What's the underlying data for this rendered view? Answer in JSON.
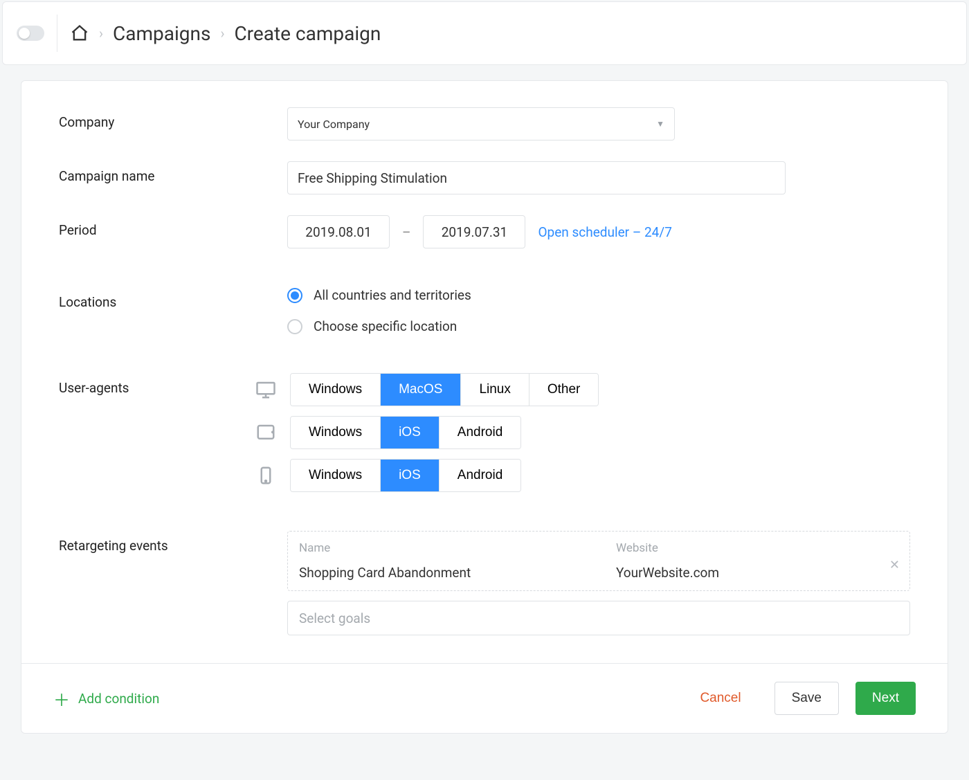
{
  "breadcrumb": {
    "level1": "Campaigns",
    "level2": "Create campaign"
  },
  "labels": {
    "company": "Company",
    "campaign_name": "Campaign name",
    "period": "Period",
    "locations": "Locations",
    "user_agents": "User-agents",
    "retargeting": "Retargeting events"
  },
  "company": {
    "value": "Your Company"
  },
  "campaign_name": {
    "value": "Free Shipping Stimulation"
  },
  "period": {
    "start": "2019.08.01",
    "end": "2019.07.31",
    "dash": "–",
    "scheduler_link": "Open scheduler – 24/7"
  },
  "locations": {
    "option_all": "All countries and territories",
    "option_specific": "Choose specific location"
  },
  "user_agents": {
    "desktop": {
      "options": [
        "Windows",
        "MacOS",
        "Linux",
        "Other"
      ],
      "active": "MacOS"
    },
    "tablet": {
      "options": [
        "Windows",
        "iOS",
        "Android"
      ],
      "active": "iOS"
    },
    "mobile": {
      "options": [
        "Windows",
        "iOS",
        "Android"
      ],
      "active": "iOS"
    }
  },
  "retargeting": {
    "header_name": "Name",
    "header_website": "Website",
    "event_name": "Shopping Card Abandonment",
    "event_website": "YourWebsite.com",
    "goals_placeholder": "Select goals"
  },
  "footer": {
    "add_condition": "Add condition",
    "cancel": "Cancel",
    "save": "Save",
    "next": "Next"
  }
}
